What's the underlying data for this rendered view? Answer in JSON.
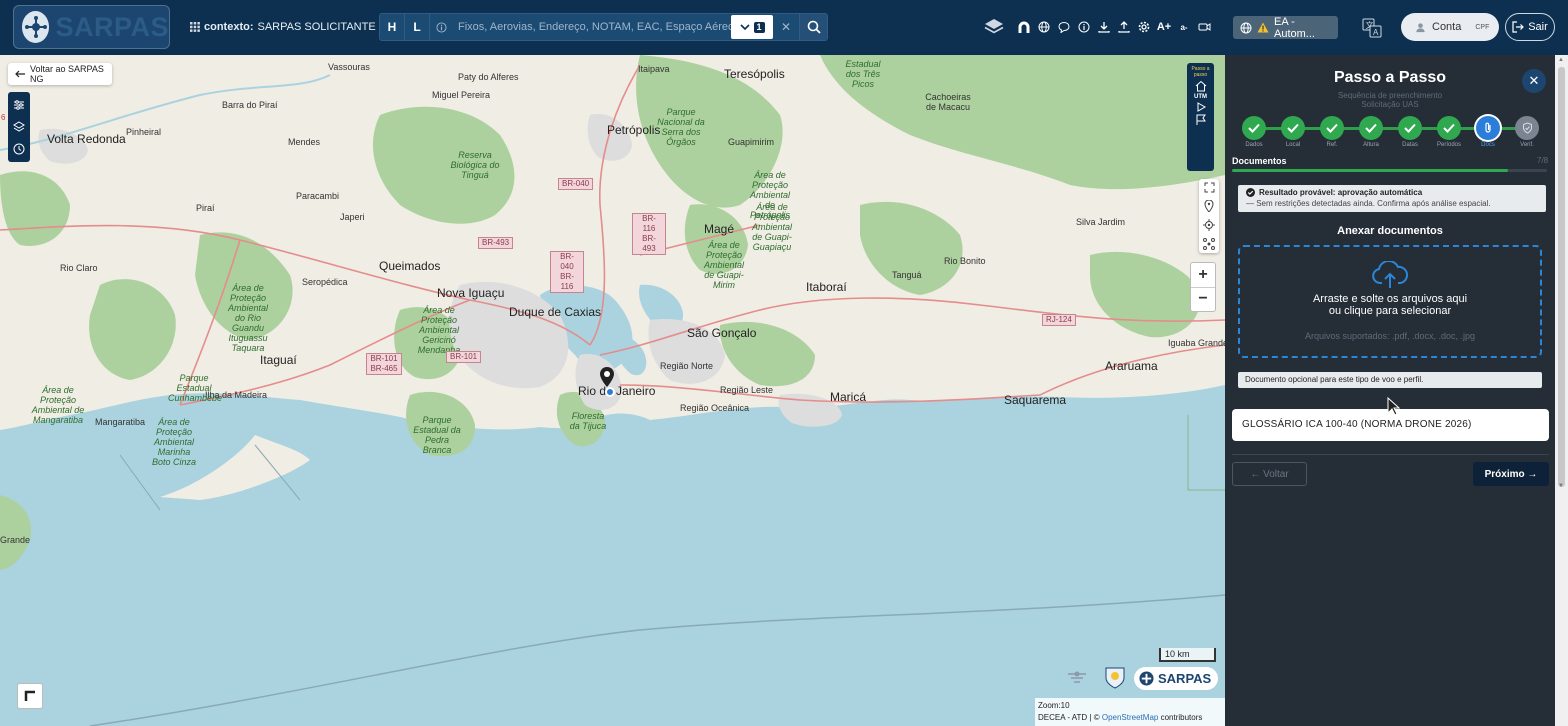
{
  "header": {
    "logo_text": "SARPAS",
    "context_label": "contexto:",
    "context_value": "SARPAS SOLICITANTE",
    "search": {
      "h_label": "H",
      "l_label": "L",
      "placeholder": "Fixos, Aerovias, Endereço, NOTAM, EAC, Espaço Aéreo (",
      "dropdown_count": "1"
    },
    "toolbar_icons": [
      "layers-icon",
      "magnet-icon",
      "globe-icon",
      "chat-icon",
      "info-icon",
      "download-icon",
      "upload-icon",
      "settings-icon",
      "font-increase-icon",
      "font-decrease-icon",
      "camera-icon"
    ],
    "font_increase_label": "A+",
    "font_decrease_label": "a-",
    "status_chip": "EA - Autom...",
    "account_label": "Conta",
    "account_sub": "CPF",
    "logout_label": "Sair"
  },
  "map": {
    "back_label": "Voltar ao SARPAS NG",
    "badge_count": "6",
    "panel_label": "Passo a passo",
    "utm_label": "UTM",
    "scale_label": "10 km",
    "zoom_in": "+",
    "zoom_out": "−",
    "zoom_text": "Zoom:10",
    "attribution_prefix": "DECEA - ATD | ©",
    "attribution_link": "OpenStreetMap",
    "attribution_suffix": "contributors",
    "brand_label": "SARPAS",
    "places": [
      {
        "name": "Vassouras"
      },
      {
        "name": "Paty do Alferes"
      },
      {
        "name": "Itaipava"
      },
      {
        "name": "Teresópolis"
      },
      {
        "name": "Barra do Piraí"
      },
      {
        "name": "Miguel Pereira"
      },
      {
        "name": "Cachoeiras de Macacu"
      },
      {
        "name": "Volta Redonda"
      },
      {
        "name": "Pinheiral"
      },
      {
        "name": "Petrópolis"
      },
      {
        "name": "Mendes"
      },
      {
        "name": "Guapimirim"
      },
      {
        "name": "Paracambi"
      },
      {
        "name": "Piraí"
      },
      {
        "name": "Japeri"
      },
      {
        "name": "Magé"
      },
      {
        "name": "Silva Jardim"
      },
      {
        "name": "Queimados"
      },
      {
        "name": "Rio Claro"
      },
      {
        "name": "Seropédica"
      },
      {
        "name": "Nova Iguaçu"
      },
      {
        "name": "Itaboraí"
      },
      {
        "name": "Tanguá"
      },
      {
        "name": "Rio Bonito"
      },
      {
        "name": "Duque de Caxias"
      },
      {
        "name": "São Gonçalo"
      },
      {
        "name": "Itaguaí"
      },
      {
        "name": "Região Norte"
      },
      {
        "name": "Rio de Janeiro"
      },
      {
        "name": "Região Leste"
      },
      {
        "name": "Maricá"
      },
      {
        "name": "Araruama"
      },
      {
        "name": "Iguaba Grande"
      },
      {
        "name": "Ilha da Madeira"
      },
      {
        "name": "Região Oceânica"
      },
      {
        "name": "Saquarema"
      },
      {
        "name": "Mangaratiba"
      },
      {
        "name": "Grande"
      }
    ],
    "parks": [
      {
        "name": "Estadual dos Três Picos"
      },
      {
        "name": "Parque Nacional da Serra dos Órgãos"
      },
      {
        "name": "Reserva Biológica do Tinguá"
      },
      {
        "name": "Área de Proteção Ambiental de Petrópolis"
      },
      {
        "name": "Área de Proteção Ambiental de Guapi-Guapiaçu"
      },
      {
        "name": "Área de Proteção Ambiental de Guapi-Mirim"
      },
      {
        "name": "Área de Proteção Ambiental do Rio Guandu Ituguassu Taquara"
      },
      {
        "name": "Área de Proteção Ambiental Gericinó Mendanha"
      },
      {
        "name": "Parque Estadual Cunhambebe"
      },
      {
        "name": "Área de Proteção Ambiental de Mangaratiba"
      },
      {
        "name": "Área de Proteção Ambiental Marinha Boto Cinza"
      },
      {
        "name": "Parque Estadual da Pedra Branca"
      },
      {
        "name": "Floresta da Tijuca"
      }
    ],
    "roads": [
      "BR-040",
      "BR-116 BR-493",
      "BR-493",
      "BR-040 BR-116",
      "BR-101 BR-465",
      "BR-101",
      "RJ-124"
    ]
  },
  "panel": {
    "title": "Passo a Passo",
    "subtitle_line1": "Sequência de preenchimento",
    "subtitle_line2": "Solicitação UAS",
    "steps": [
      {
        "label": "Dados",
        "status": "done"
      },
      {
        "label": "Local",
        "status": "done"
      },
      {
        "label": "Ref.",
        "status": "done"
      },
      {
        "label": "Altura",
        "status": "done"
      },
      {
        "label": "Datas",
        "status": "done"
      },
      {
        "label": "Períodos",
        "status": "done"
      },
      {
        "label": "Docs",
        "status": "active"
      },
      {
        "label": "Verif.",
        "status": "todo"
      }
    ],
    "section_title": "Documentos",
    "section_count": "7/8",
    "progress_fraction": 0.875,
    "result_title": "Resultado provável: aprovação automática",
    "result_detail": "— Sem restrições detectadas ainda. Confirma após análise espacial.",
    "attach_title": "Anexar documentos",
    "dropzone_line1": "Arraste e solte os arquivos aqui",
    "dropzone_line2": "ou clique para selecionar",
    "dropzone_formats": "Arquivos suportados: .pdf, .docx, .doc, .jpg",
    "optional_note": "Documento opcional para este tipo de voo e perfil.",
    "document_item": "GLOSSÁRIO ICA 100-40 (NORMA DRONE 2026)",
    "back_button": "← Voltar",
    "next_button": "Próximo →"
  },
  "colors": {
    "topbar": "#0d3050",
    "panel": "#252d37",
    "step_done": "#2fa84f",
    "step_active": "#2a7dd8",
    "water": "#aad3df",
    "forest": "#add19e",
    "urban": "#dddddd"
  }
}
